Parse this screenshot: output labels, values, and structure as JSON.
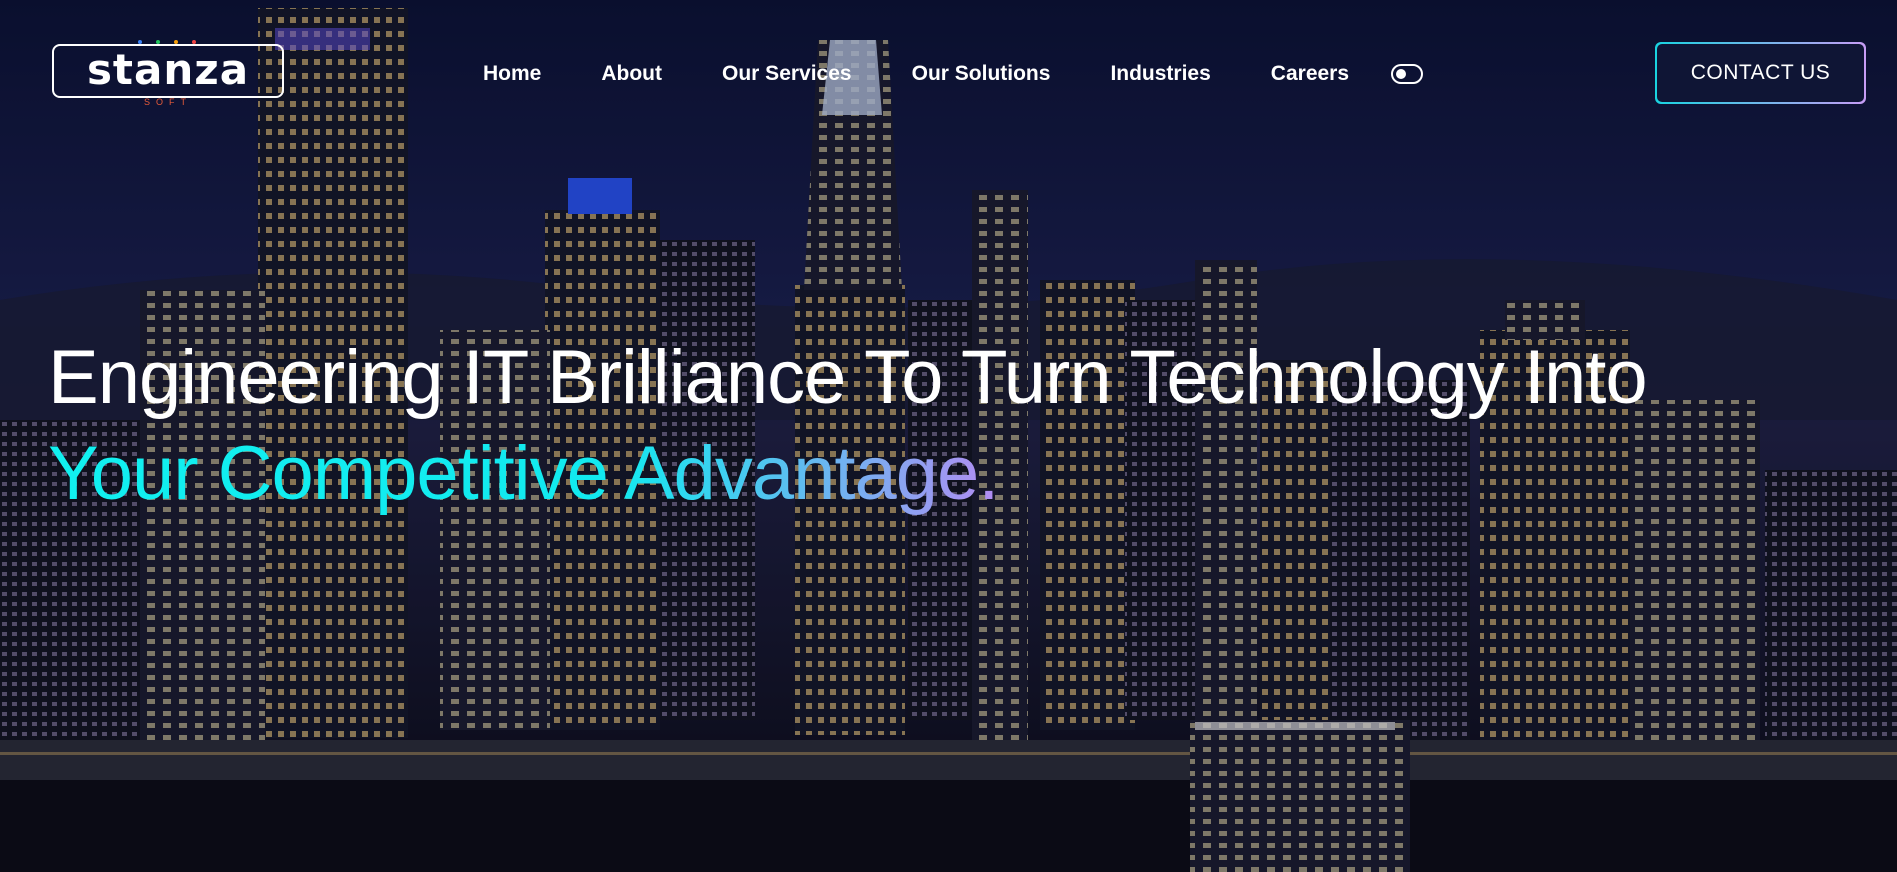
{
  "brand": {
    "name": "stanza",
    "tagline": "SOFT",
    "dot_colors": [
      "#3b82f6",
      "#22c55e",
      "#f59e0b",
      "#ef4444"
    ]
  },
  "nav": {
    "items": [
      {
        "label": "Home"
      },
      {
        "label": "About"
      },
      {
        "label": "Our Services"
      },
      {
        "label": "Our Solutions"
      },
      {
        "label": "Industries"
      },
      {
        "label": "Careers"
      }
    ],
    "theme_toggle_icon": "toggle-switch-icon"
  },
  "cta": {
    "label": "CONTACT US",
    "gradient": [
      "#19d3e0",
      "#c79cf5"
    ]
  },
  "hero": {
    "line1": "Engineering IT Brilliance To Turn Technology Into",
    "line2": "Your Competitive Advantage.",
    "accent_color": "#11f0f0",
    "background": "night-city-skyline"
  }
}
